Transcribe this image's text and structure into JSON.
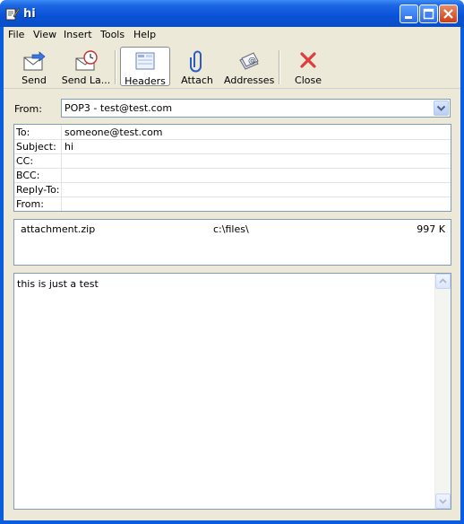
{
  "window": {
    "title": "hi"
  },
  "menu": {
    "items": [
      "File",
      "View",
      "Insert",
      "Tools",
      "Help"
    ]
  },
  "toolbar": {
    "send": "Send",
    "send_later": "Send La...",
    "headers": "Headers",
    "attach": "Attach",
    "addresses": "Addresses",
    "close": "Close"
  },
  "from": {
    "label": "From:",
    "value": "POP3 - test@test.com"
  },
  "headers": [
    {
      "key": "To:",
      "value": "someone@test.com"
    },
    {
      "key": "Subject:",
      "value": "hi"
    },
    {
      "key": "CC:",
      "value": ""
    },
    {
      "key": "BCC:",
      "value": ""
    },
    {
      "key": "Reply-To:",
      "value": ""
    },
    {
      "key": "From:",
      "value": ""
    }
  ],
  "attachment": {
    "name": "attachment.zip",
    "path": "c:\\files\\",
    "size": "997 K"
  },
  "body": {
    "text": "this is just a test"
  },
  "icons": {
    "app": "compose-message-icon",
    "send": "send-envelope-icon",
    "send_later": "clock-envelope-icon",
    "headers": "headers-icon",
    "attach": "paperclip-icon",
    "addresses": "address-book-icon",
    "close": "close-x-icon"
  },
  "colors": {
    "titlebar": "#0a52d6",
    "client": "#ece9d8",
    "border": "#7f9db9",
    "close_red": "#e03c3c"
  }
}
